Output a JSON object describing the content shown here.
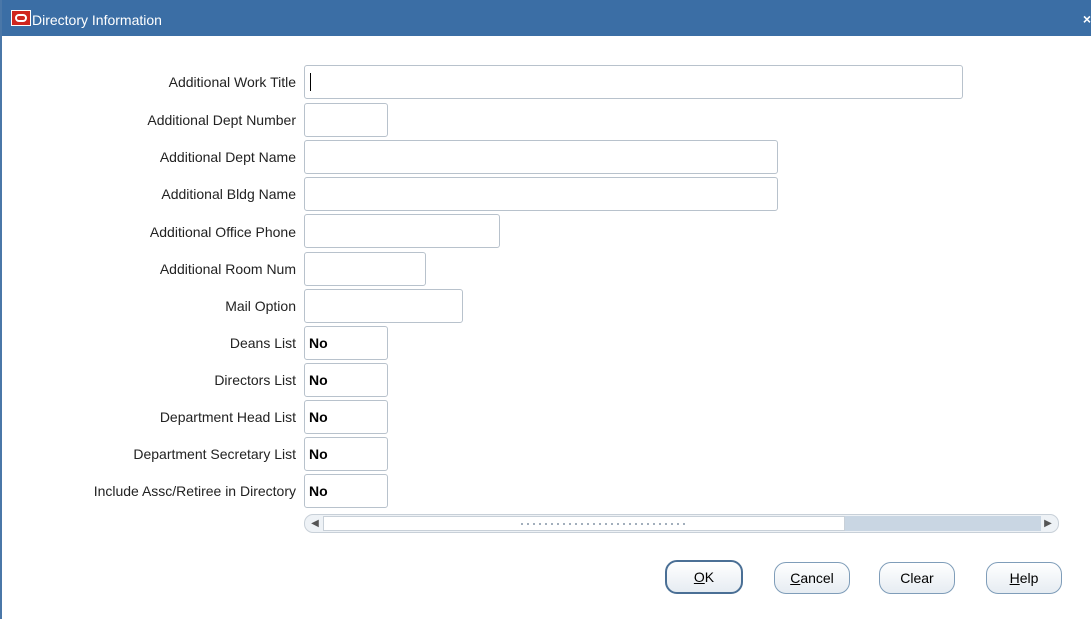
{
  "window": {
    "title": "Directory Information",
    "close_glyph": "×"
  },
  "icons": {
    "app_logo": "oracle-logo-icon",
    "close": "close-icon",
    "scroll_left": "arrow-left-icon",
    "scroll_right": "arrow-right-icon"
  },
  "colors": {
    "titlebar": "#3b6ea5",
    "logo": "#d0261e"
  },
  "fields": [
    {
      "label": "Additional Work Title",
      "value": ""
    },
    {
      "label": "Additional Dept Number",
      "value": ""
    },
    {
      "label": "Additional Dept Name",
      "value": ""
    },
    {
      "label": "Additional Bldg Name",
      "value": ""
    },
    {
      "label": "Additional Office Phone",
      "value": ""
    },
    {
      "label": "Additional Room Num",
      "value": ""
    },
    {
      "label": "Mail Option",
      "value": ""
    },
    {
      "label": "Deans List",
      "value": "No"
    },
    {
      "label": "Directors List",
      "value": "No"
    },
    {
      "label": "Department Head List",
      "value": "No"
    },
    {
      "label": "Department Secretary List",
      "value": "No"
    },
    {
      "label": "Include Assc/Retiree in Directory",
      "value": "No"
    }
  ],
  "buttons": {
    "ok": {
      "mnemonic": "O",
      "rest": "K"
    },
    "cancel": {
      "mnemonic": "C",
      "rest": "ancel"
    },
    "clear": {
      "label": "Clear"
    },
    "help": {
      "mnemonic": "H",
      "rest": "elp"
    }
  }
}
